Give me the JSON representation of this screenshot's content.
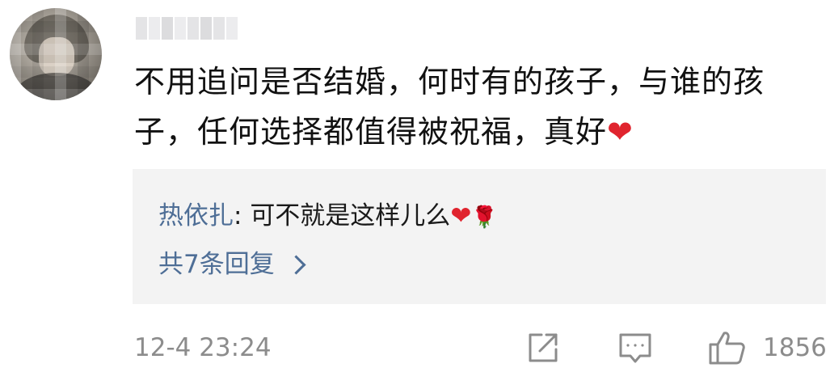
{
  "comment": {
    "text_line1": "不用追问是否结婚，何时有的孩子，与谁的孩",
    "text_line2": "子，任何选择都值得被祝福，真好",
    "emoji": "❤"
  },
  "reply": {
    "author": "热依扎",
    "separator": ": ",
    "text": "可不就是这样儿么",
    "emoji_heart": "❤",
    "emoji_rose": "🌹"
  },
  "replies_link": {
    "label": "共7条回复"
  },
  "footer": {
    "timestamp": "12-4 23:24",
    "like_count": "1856"
  },
  "icons": {
    "share": "share-icon",
    "comment": "comment-icon",
    "like": "thumbs-up-icon",
    "chevron": "chevron-right-icon"
  },
  "colors": {
    "link_blue": "#4e6e96",
    "heart_red": "#e0242e",
    "meta_gray": "#8c8c8c",
    "reply_bg": "#f3f3f3"
  }
}
